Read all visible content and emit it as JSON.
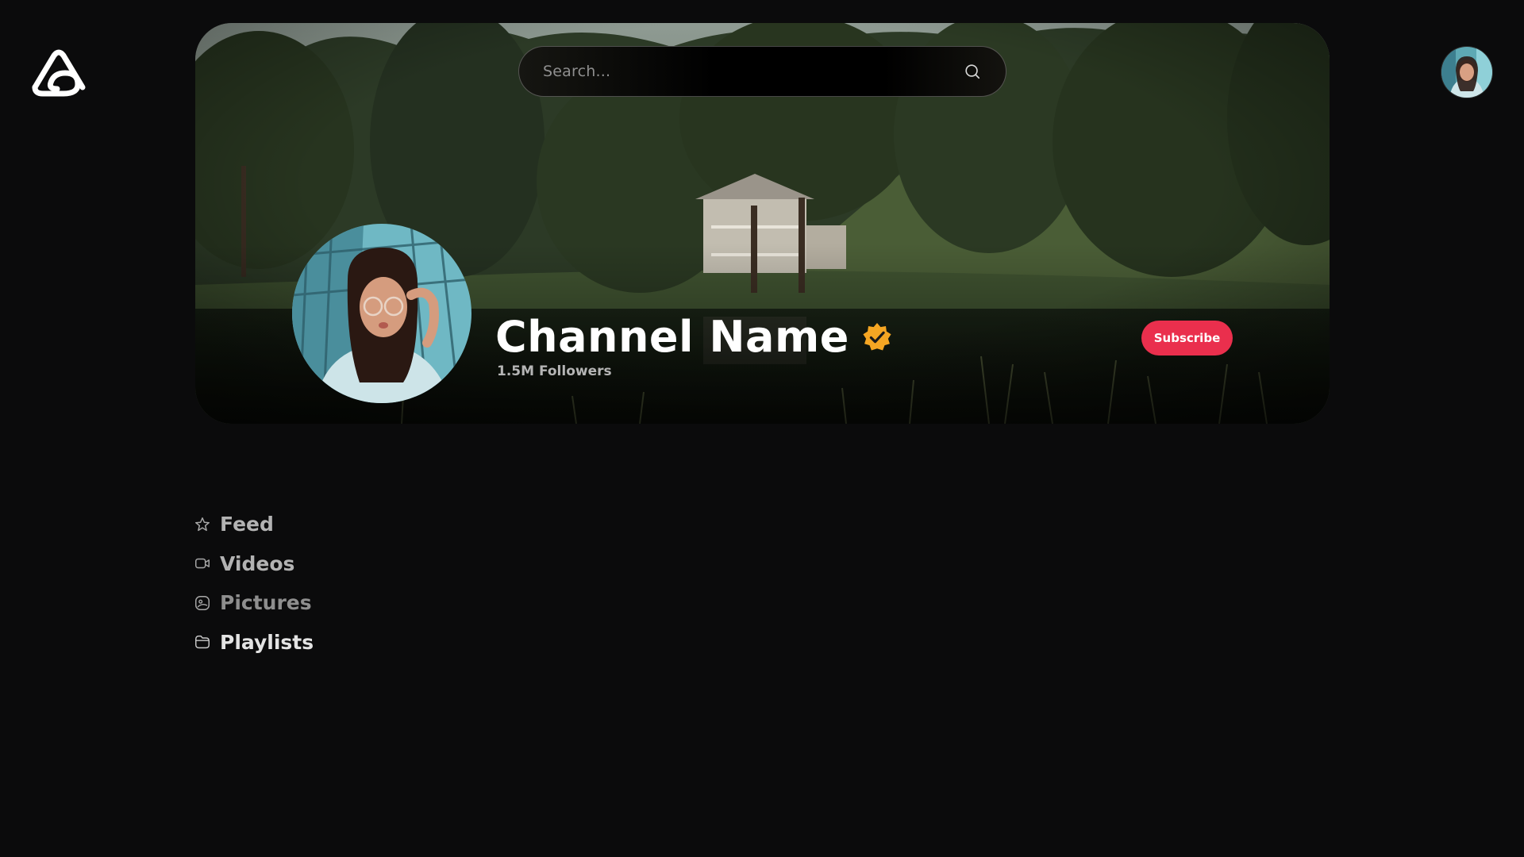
{
  "search": {
    "placeholder": "Search..."
  },
  "channel": {
    "name": "Channel Name",
    "followers": "1.5M Followers",
    "verified": true
  },
  "actions": {
    "subscribe_label": "Subscribe"
  },
  "nav": {
    "items": [
      {
        "label": "Feed",
        "icon": "star-icon"
      },
      {
        "label": "Videos",
        "icon": "video-camera-icon"
      },
      {
        "label": "Pictures",
        "icon": "image-icon"
      },
      {
        "label": "Playlists",
        "icon": "folder-icon"
      }
    ]
  },
  "colors": {
    "background": "#0b0b0c",
    "accent": "#ea2f4d",
    "verified_badge": "#f5a623"
  }
}
